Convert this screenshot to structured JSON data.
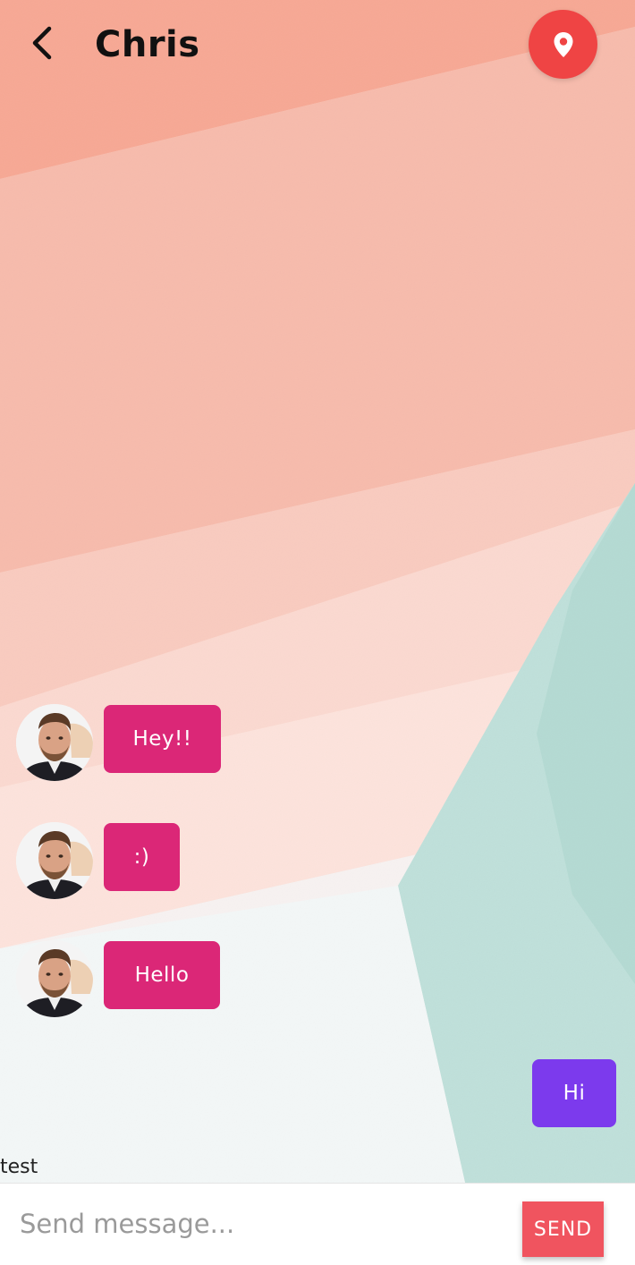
{
  "header": {
    "back_icon": "chevron-left-icon",
    "title": "Chris",
    "location_icon": "map-pin-icon",
    "location_button_color": "#ef4444"
  },
  "messages": [
    {
      "direction": "incoming",
      "text": "Hey!!",
      "color": "#db2777"
    },
    {
      "direction": "incoming",
      "text": ":)",
      "color": "#db2777"
    },
    {
      "direction": "incoming",
      "text": "Hello",
      "color": "#db2777"
    },
    {
      "direction": "outgoing",
      "text": "Hi",
      "color": "#7c3aed"
    }
  ],
  "footer_label": "test",
  "composer": {
    "placeholder": "Send message...",
    "value": "",
    "send_label": "SEND",
    "send_color": "#f0545f"
  }
}
